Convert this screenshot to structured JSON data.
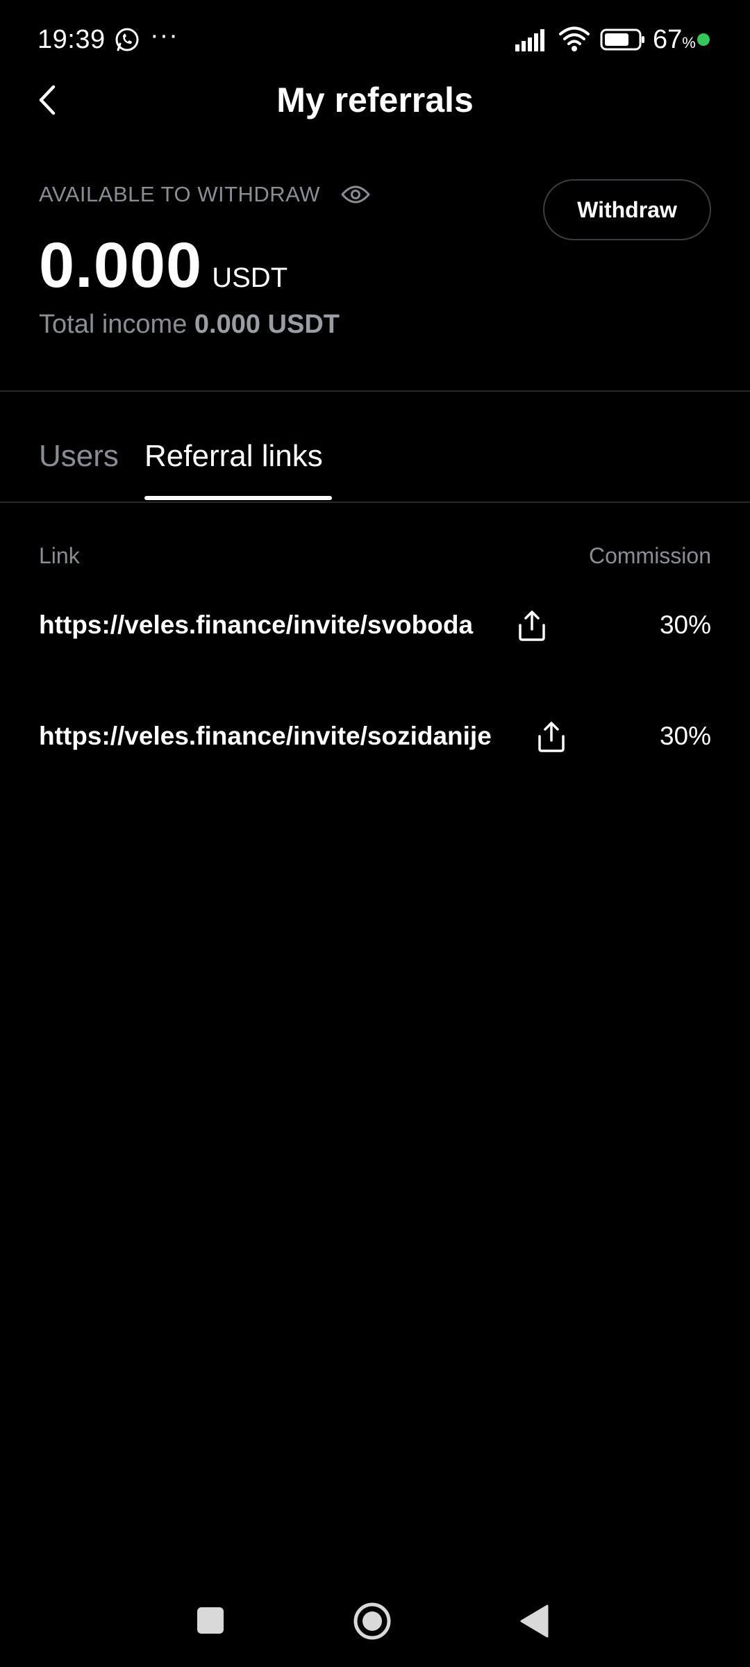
{
  "status_bar": {
    "time": "19:39",
    "dots": "···",
    "battery_percent": "67",
    "battery_unit": "%",
    "icons": [
      "whatsapp-icon",
      "signal-icon",
      "wifi-icon",
      "battery-icon"
    ],
    "charging_dot_color": "#35c759"
  },
  "header": {
    "title": "My referrals",
    "back_icon": "chevron-left-icon"
  },
  "balance": {
    "available_label": "AVAILABLE TO WITHDRAW",
    "value": "0.000",
    "unit": "USDT",
    "withdraw_label": "Withdraw",
    "total_income_label": "Total income",
    "total_income_value": "0.000 USDT"
  },
  "tabs": [
    {
      "label": "Users",
      "active": false
    },
    {
      "label": "Referral links",
      "active": true
    }
  ],
  "table": {
    "columns": {
      "link": "Link",
      "commission": "Commission"
    },
    "rows": [
      {
        "url": "https://veles.finance/invite/svoboda",
        "commission": "30%"
      },
      {
        "url": "https://veles.finance/invite/sozidanije",
        "commission": "30%"
      }
    ]
  },
  "nav_bar": {
    "icons": [
      "recents-square-icon",
      "home-circle-icon",
      "back-triangle-icon"
    ]
  },
  "colors": {
    "background": "#000000",
    "text_primary": "#ffffff",
    "text_secondary": "#8a8d93",
    "divider": "#2a2a2d"
  }
}
